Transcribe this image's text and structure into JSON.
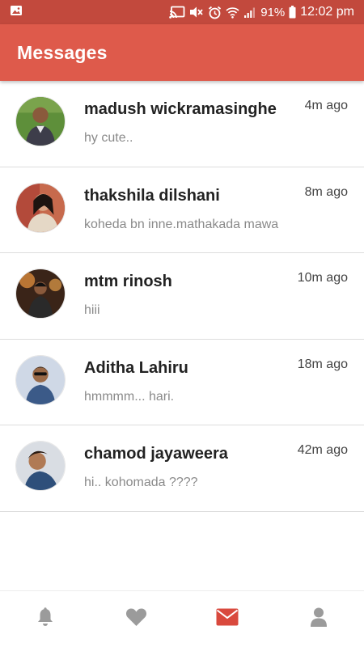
{
  "status_bar": {
    "battery": "91%",
    "time": "12:02 pm",
    "icons": [
      "image-icon",
      "cast-icon",
      "mute-icon",
      "alarm-icon",
      "wifi-icon",
      "signal-icon",
      "battery-icon"
    ]
  },
  "header": {
    "title": "Messages"
  },
  "messages": [
    {
      "name": "madush wickramasinghe",
      "time": "4m ago",
      "preview": "hy cute.."
    },
    {
      "name": "thakshila dilshani",
      "time": "8m ago",
      "preview": "koheda bn inne.mathakada mawa"
    },
    {
      "name": "mtm rinosh",
      "time": "10m ago",
      "preview": "hiii"
    },
    {
      "name": "Aditha Lahiru",
      "time": "18m ago",
      "preview": "hmmmm... hari."
    },
    {
      "name": "chamod jayaweera",
      "time": "42m ago",
      "preview": "hi.. kohomada ????"
    }
  ],
  "bottom_nav": {
    "items": [
      "bell-icon",
      "heart-icon",
      "envelope-icon",
      "person-icon"
    ],
    "active": "envelope-icon"
  },
  "colors": {
    "status_bar": "#c2493d",
    "app_bar": "#de5a4b",
    "accent": "#d9493d",
    "inactive_icon": "#9b9b9b"
  }
}
